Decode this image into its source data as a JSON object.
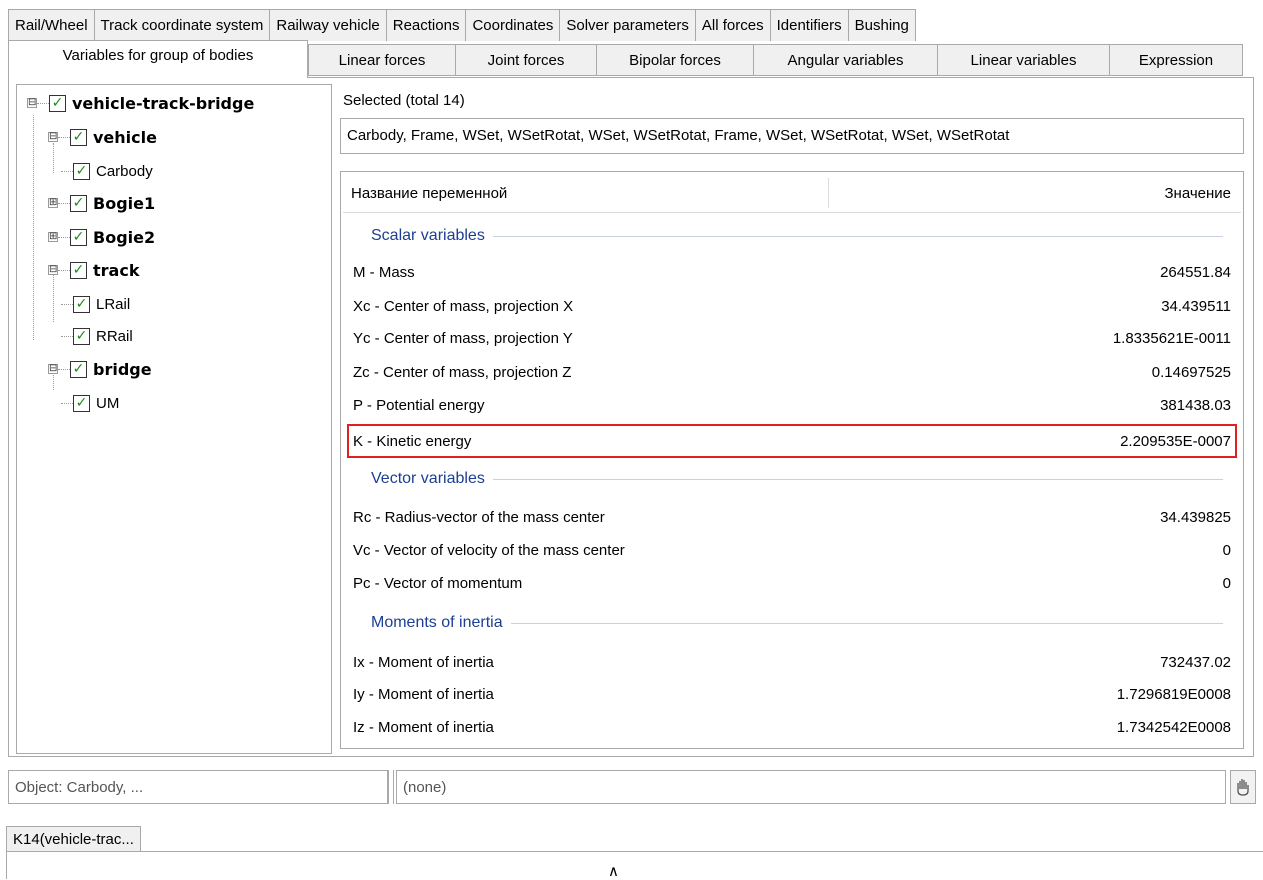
{
  "tabs_row1": [
    "Rail/Wheel",
    "Track coordinate system",
    "Railway vehicle",
    "Reactions",
    "Coordinates",
    "Solver parameters",
    "All forces",
    "Identifiers",
    "Bushing"
  ],
  "active_tab": "Variables for group of bodies",
  "tabs_row2": [
    "Linear forces",
    "Joint forces",
    "Bipolar forces",
    "Angular variables",
    "Linear variables",
    "Expression"
  ],
  "tree": {
    "root": "vehicle-track-bridge",
    "vehicle": "vehicle",
    "carbody": "Carbody",
    "bogie1": "Bogie1",
    "bogie2": "Bogie2",
    "track": "track",
    "lrail": "LRail",
    "rrail": "RRail",
    "bridge": "bridge",
    "um": "UM",
    "expand_symbol": "⊟",
    "collapse_symbol": "⊞",
    "check_symbol": "✓"
  },
  "selected": {
    "title": "Selected (total 14)",
    "value": "Carbody, Frame, WSet, WSetRotat, WSet, WSetRotat, Frame, WSet, WSetRotat, WSet, WSetRotat"
  },
  "table": {
    "col_name": "Название переменной",
    "col_value": "Значение",
    "groups": {
      "scalar": "Scalar variables",
      "vector": "Vector variables",
      "moments": "Moments of inertia"
    },
    "scalar_rows": [
      {
        "name": "M - Mass",
        "value": "264551.84"
      },
      {
        "name": "Xc - Center of mass, projection X",
        "value": "34.439511"
      },
      {
        "name": "Yc - Center of mass, projection Y",
        "value": "1.8335621E-0011"
      },
      {
        "name": "Zc - Center of mass, projection Z",
        "value": "0.14697525"
      },
      {
        "name": "P - Potential energy",
        "value": "381438.03"
      },
      {
        "name": "K - Kinetic energy",
        "value": "2.209535E-0007"
      }
    ],
    "vector_rows": [
      {
        "name": "Rc - Radius-vector of the mass center",
        "value": "34.439825"
      },
      {
        "name": "Vc - Vector of velocity of the mass center",
        "value": "0"
      },
      {
        "name": "Pc - Vector of momentum",
        "value": "0"
      }
    ],
    "moment_rows": [
      {
        "name": "Ix - Moment of inertia",
        "value": "732437.02"
      },
      {
        "name": "Iy - Moment of inertia",
        "value": "1.7296819E0008"
      },
      {
        "name": "Iz - Moment of inertia",
        "value": "1.7342542E0008"
      }
    ]
  },
  "object_field": "Object: Carbody, ...",
  "expression_field": "(none)",
  "bottom_tag": "K14(vehicle-trac...",
  "caret_symbol": "∧",
  "colors": {
    "highlight": "#e01f1f",
    "group_header": "#1c3f94",
    "check": "#1a8a1a"
  }
}
